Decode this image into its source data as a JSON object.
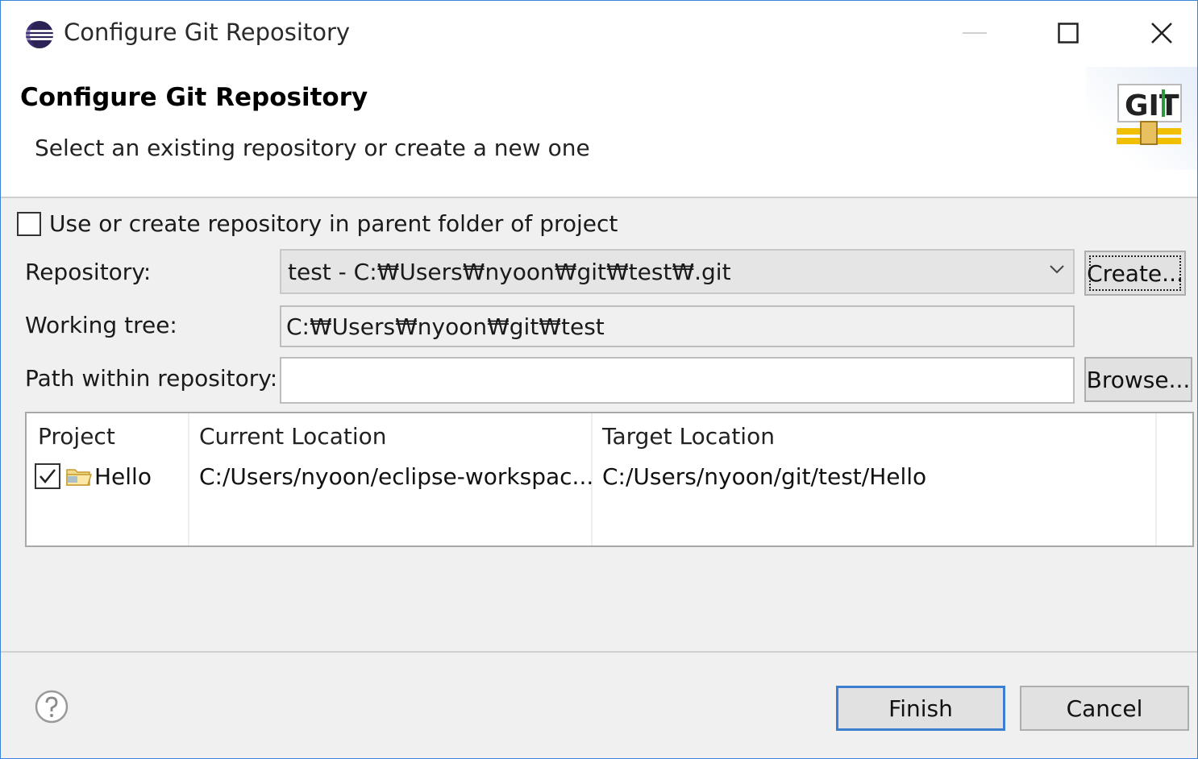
{
  "window": {
    "title": "Configure Git Repository",
    "controls": {
      "minimize_icon": "minimize-icon",
      "maximize_icon": "maximize-icon",
      "close_icon": "close-icon"
    }
  },
  "header": {
    "title": "Configure Git Repository",
    "subtitle": "Select an existing repository or create a new one",
    "logo_text": "GIT"
  },
  "form": {
    "use_parent_folder": {
      "label": "Use or create repository in parent folder of project",
      "checked": false
    },
    "repository": {
      "label": "Repository:",
      "value": "test - C:₩Users₩nyoon₩git₩test₩.git",
      "create_button": "Create..."
    },
    "working_tree": {
      "label": "Working tree:",
      "value": "C:₩Users₩nyoon₩git₩test"
    },
    "path_within_repository": {
      "label": "Path within repository:",
      "value": "",
      "browse_button": "Browse..."
    }
  },
  "table": {
    "columns": [
      "Project",
      "Current Location",
      "Target Location"
    ],
    "rows": [
      {
        "checked": true,
        "project": "Hello",
        "current_location": "C:/Users/nyoon/eclipse-workspac...",
        "target_location": "C:/Users/nyoon/git/test/Hello"
      }
    ]
  },
  "footer": {
    "help_icon": "help-icon",
    "finish_button": "Finish",
    "cancel_button": "Cancel"
  },
  "colors": {
    "accent": "#3c7fd0",
    "window_bg": "#f0f0f0"
  }
}
